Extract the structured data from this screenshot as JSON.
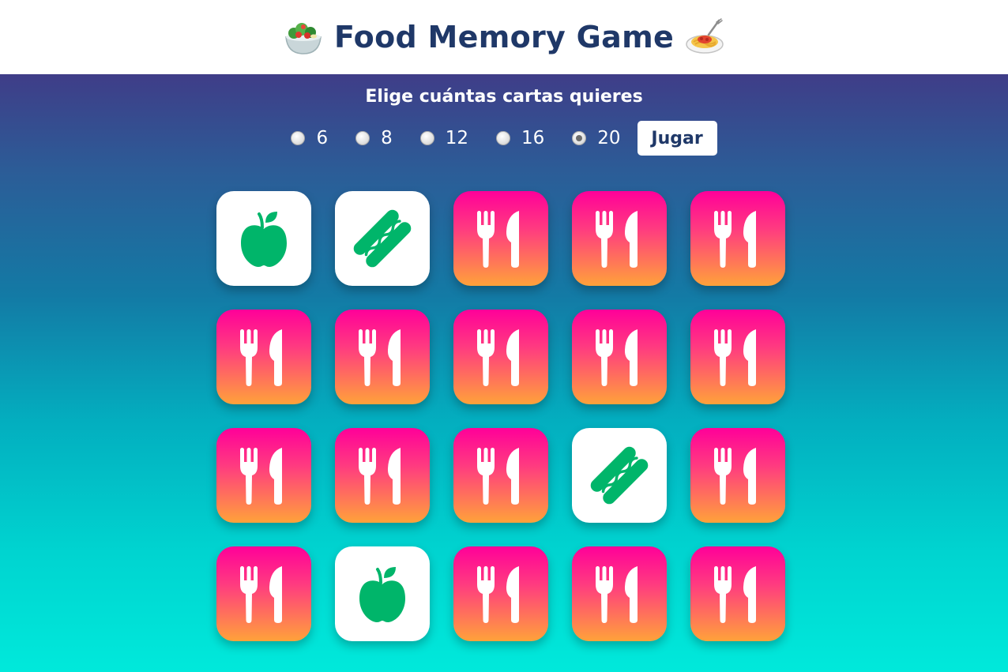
{
  "header": {
    "title": "Food Memory Game",
    "left_icon": "salad-icon",
    "right_icon": "spaghetti-icon"
  },
  "setup": {
    "prompt": "Elige cuántas cartas quieres",
    "options": [
      {
        "label": "6",
        "checked": false
      },
      {
        "label": "8",
        "checked": false
      },
      {
        "label": "12",
        "checked": false
      },
      {
        "label": "16",
        "checked": false
      },
      {
        "label": "20",
        "checked": true
      }
    ],
    "play_label": "Jugar"
  },
  "board": {
    "rows": 4,
    "columns": 5,
    "cards": [
      {
        "state": "revealed",
        "icon": "apple-icon"
      },
      {
        "state": "revealed",
        "icon": "hotdog-icon"
      },
      {
        "state": "hidden",
        "icon": "fork-knife-icon"
      },
      {
        "state": "hidden",
        "icon": "fork-knife-icon"
      },
      {
        "state": "hidden",
        "icon": "fork-knife-icon"
      },
      {
        "state": "hidden",
        "icon": "fork-knife-icon"
      },
      {
        "state": "hidden",
        "icon": "fork-knife-icon"
      },
      {
        "state": "hidden",
        "icon": "fork-knife-icon"
      },
      {
        "state": "hidden",
        "icon": "fork-knife-icon"
      },
      {
        "state": "hidden",
        "icon": "fork-knife-icon"
      },
      {
        "state": "hidden",
        "icon": "fork-knife-icon"
      },
      {
        "state": "hidden",
        "icon": "fork-knife-icon"
      },
      {
        "state": "hidden",
        "icon": "fork-knife-icon"
      },
      {
        "state": "revealed",
        "icon": "hotdog-icon"
      },
      {
        "state": "hidden",
        "icon": "fork-knife-icon"
      },
      {
        "state": "hidden",
        "icon": "fork-knife-icon"
      },
      {
        "state": "revealed",
        "icon": "apple-icon"
      },
      {
        "state": "hidden",
        "icon": "fork-knife-icon"
      },
      {
        "state": "hidden",
        "icon": "fork-knife-icon"
      },
      {
        "state": "hidden",
        "icon": "fork-knife-icon"
      }
    ]
  },
  "colors": {
    "title": "#1f3868",
    "card_back_top": "#ff0099",
    "card_back_bottom": "#ffa23a",
    "food_icon": "#00b56a",
    "background_top": "#3f3d88",
    "background_bottom": "#00e9db"
  }
}
